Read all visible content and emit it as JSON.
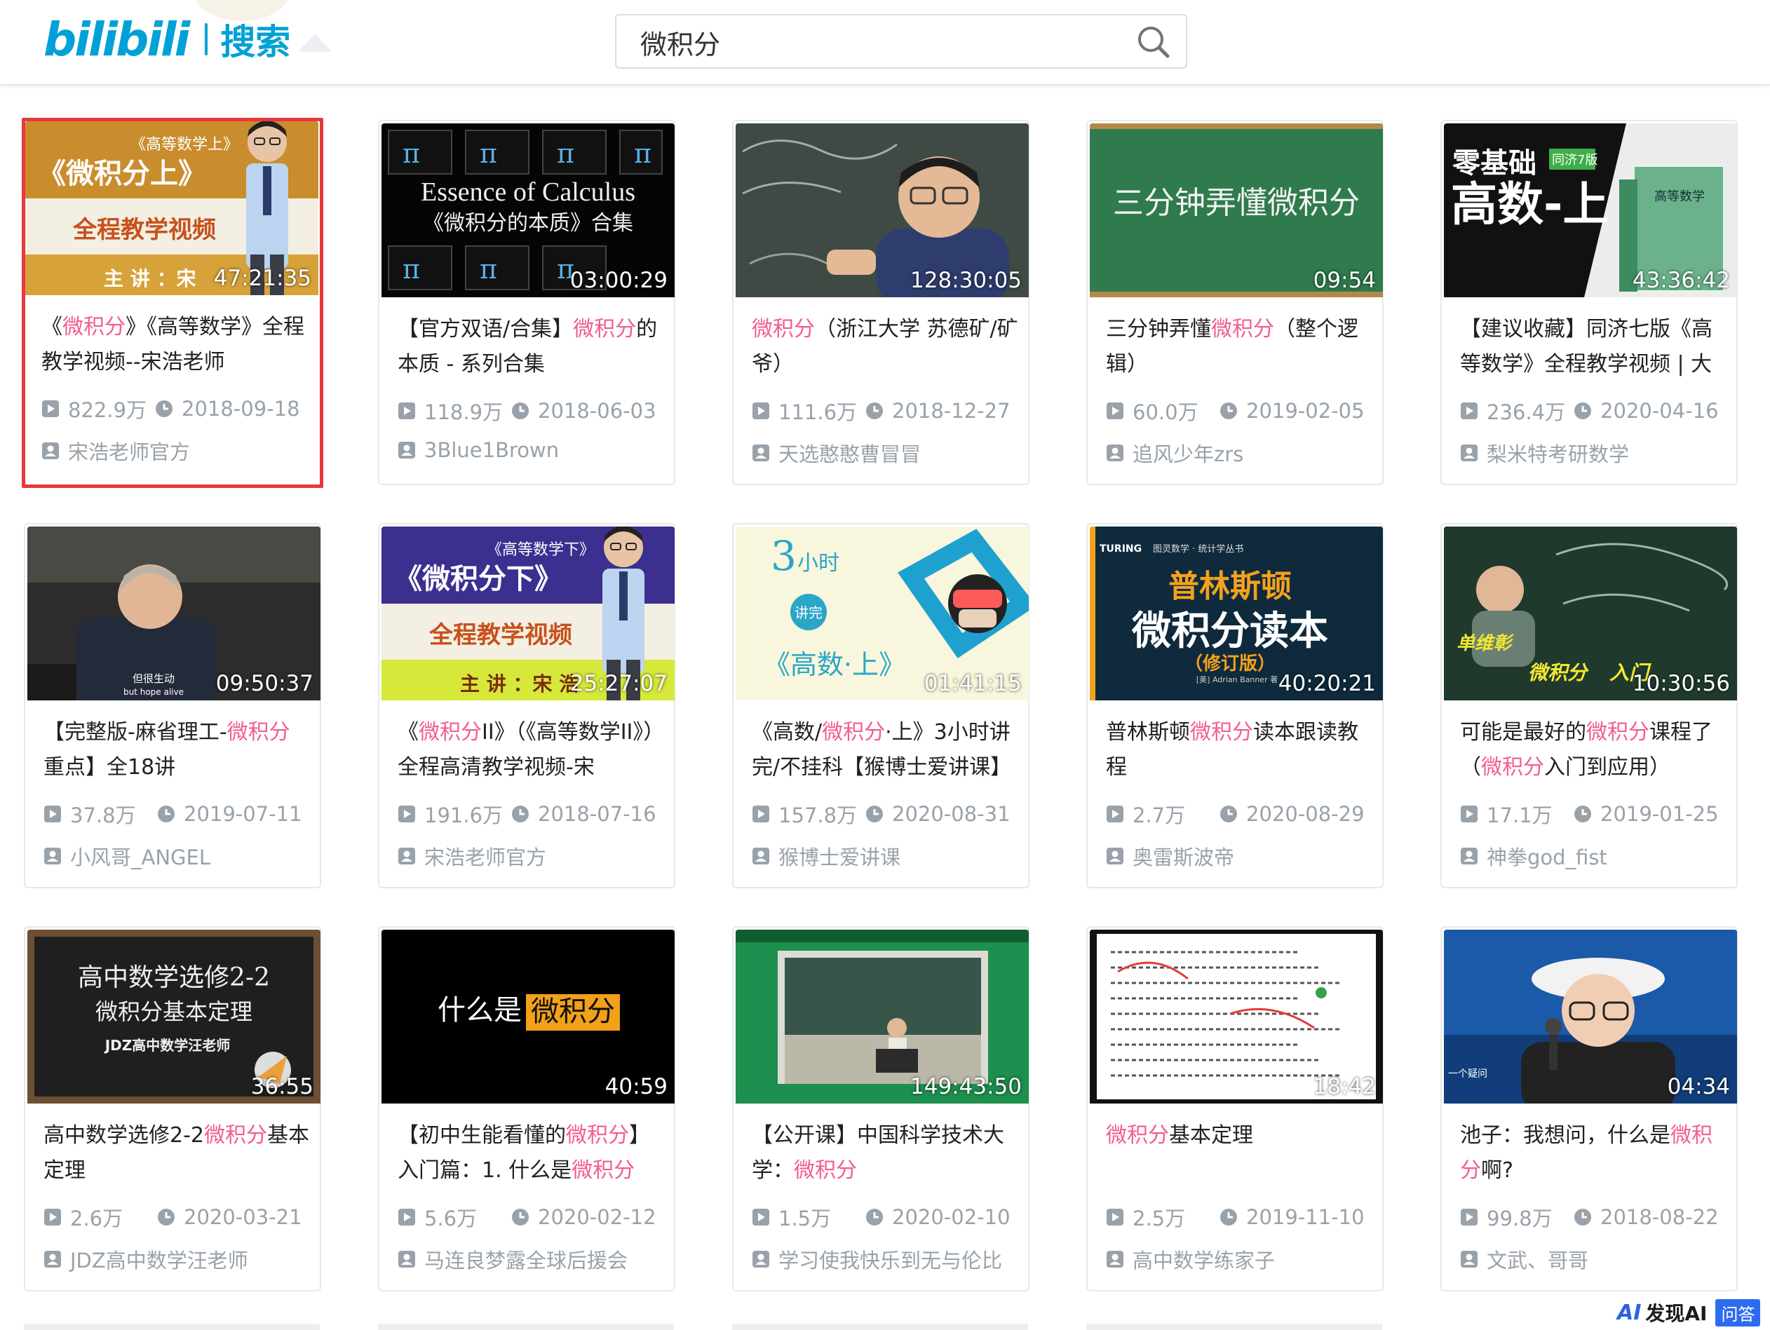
{
  "header": {
    "logo_text": "bilibili",
    "logo_subtitle": "搜索",
    "search_value": "微积分"
  },
  "cards": [
    {
      "title_parts": [
        [
          "《",
          0
        ],
        [
          "微积分",
          1
        ],
        [
          "》《高等数学》全程教学视频--宋浩老师",
          0
        ]
      ],
      "duration": "47:21:35",
      "views": "822.9万",
      "date": "2018-09-18",
      "author": "宋浩老师官方",
      "selected": true
    },
    {
      "title_parts": [
        [
          "【官方双语/合集】",
          0
        ],
        [
          "微积分",
          1
        ],
        [
          "的本质 - 系列合集",
          0
        ]
      ],
      "duration": "03:00:29",
      "views": "118.9万",
      "date": "2018-06-03",
      "author": "3Blue1Brown"
    },
    {
      "title_parts": [
        [
          "微积分",
          1
        ],
        [
          "（浙江大学 苏德矿/矿爷）",
          0
        ]
      ],
      "duration": "128:30:05",
      "views": "111.6万",
      "date": "2018-12-27",
      "author": "天选憨憨曹冒冒"
    },
    {
      "title_parts": [
        [
          "三分钟弄懂",
          0
        ],
        [
          "微积分",
          1
        ],
        [
          "（整个逻辑）",
          0
        ]
      ],
      "duration": "09:54",
      "views": "60.0万",
      "date": "2019-02-05",
      "author": "追风少年zrs"
    },
    {
      "title_parts": [
        [
          "【建议收藏】同济七版《高等数学》全程教学视频 | 大",
          0
        ]
      ],
      "duration": "43:36:42",
      "views": "236.4万",
      "date": "2020-04-16",
      "author": "梨米特考研数学"
    },
    {
      "title_parts": [
        [
          "【完整版-麻省理工-",
          0
        ],
        [
          "微积分",
          1
        ],
        [
          "重点】全18讲",
          0
        ]
      ],
      "duration": "09:50:37",
      "views": "37.8万",
      "date": "2019-07-11",
      "author": "小风哥_ANGEL"
    },
    {
      "title_parts": [
        [
          "《",
          0
        ],
        [
          "微积分",
          1
        ],
        [
          "II》（《高等数学II》）全程高清教学视频-宋",
          0
        ]
      ],
      "duration": "25:27:07",
      "views": "191.6万",
      "date": "2018-07-16",
      "author": "宋浩老师官方"
    },
    {
      "title_parts": [
        [
          "《高数/",
          0
        ],
        [
          "微积分",
          1
        ],
        [
          "·上》3小时讲完/不挂科【猴博士爱讲课】",
          0
        ]
      ],
      "duration": "01:41:15",
      "views": "157.8万",
      "date": "2020-08-31",
      "author": "猴博士爱讲课"
    },
    {
      "title_parts": [
        [
          "普林斯顿",
          0
        ],
        [
          "微积分",
          1
        ],
        [
          "读本跟读教程",
          0
        ]
      ],
      "duration": "40:20:21",
      "views": "2.7万",
      "date": "2020-08-29",
      "author": "奥雷斯波帝"
    },
    {
      "title_parts": [
        [
          "可能是最好的",
          0
        ],
        [
          "微积分",
          1
        ],
        [
          "课程了（",
          0
        ],
        [
          "微积分",
          1
        ],
        [
          "入门到应用）",
          0
        ]
      ],
      "duration": "10:30:56",
      "views": "17.1万",
      "date": "2019-01-25",
      "author": "神拳god_fist"
    },
    {
      "title_parts": [
        [
          "高中数学选修2-2",
          0
        ],
        [
          "微积分",
          1
        ],
        [
          "基本定理",
          0
        ]
      ],
      "duration": "36:55",
      "views": "2.6万",
      "date": "2020-03-21",
      "author": "JDZ高中数学汪老师"
    },
    {
      "title_parts": [
        [
          "【初中生能看懂的",
          0
        ],
        [
          "微积分",
          1
        ],
        [
          "】入门篇：1. 什么是",
          0
        ],
        [
          "微积分",
          1
        ]
      ],
      "duration": "40:59",
      "views": "5.6万",
      "date": "2020-02-12",
      "author": "马连良梦露全球后援会"
    },
    {
      "title_parts": [
        [
          "【公开课】中国科学技术大学：",
          0
        ],
        [
          "微积分",
          1
        ]
      ],
      "duration": "149:43:50",
      "views": "1.5万",
      "date": "2020-02-10",
      "author": "学习使我快乐到无与伦比"
    },
    {
      "title_parts": [
        [
          "微积分",
          1
        ],
        [
          "基本定理",
          0
        ]
      ],
      "duration": "18:42",
      "views": "2.5万",
      "date": "2019-11-10",
      "author": "高中数学练家子"
    },
    {
      "title_parts": [
        [
          "池子：我想问，什么是",
          0
        ],
        [
          "微积分",
          1
        ],
        [
          "啊?",
          0
        ]
      ],
      "duration": "04:34",
      "views": "99.8万",
      "date": "2018-08-22",
      "author": "文武、哥哥"
    }
  ],
  "thumb_text": {
    "t1": {
      "top": "《高等数学上》",
      "main": "《微积分上》",
      "band": "全程教学视频",
      "lect": "主 讲 ：宋"
    },
    "t2": {
      "l1": "Essence of Calculus",
      "l2": "《微积分的本质》合集"
    },
    "t4": {
      "main": "三分钟弄懂微积分"
    },
    "t5": {
      "a": "零基础",
      "b": "高数-上",
      "badge": "同济7版",
      "book": "高等数学"
    },
    "t6": {
      "sub": "但很生动",
      "sub2": "but hope alive"
    },
    "t7": {
      "top": "《高等数学下》",
      "main": "《微积分下》",
      "band": "全程教学视频",
      "lect": "主 讲 ：宋 浩"
    },
    "t8": {
      "num": "3",
      "unit": "小时",
      "badge": "讲完",
      "main": "《高数·上》"
    },
    "t9": {
      "brand": "TURING",
      "series": "图灵数学 · 统计学丛书",
      "l1": "普林斯顿",
      "l2": "微积分读本",
      "l3": "（修订版）",
      "author": "[美] Adrian Banner 著"
    },
    "t10": {
      "a": "单维彰",
      "b": "微积分",
      "c": "入门"
    },
    "t11": {
      "l1": "高中数学选修2-2",
      "l2": "微积分基本定理",
      "l3": "JDZ高中数学汪老师"
    },
    "t12": {
      "a": "什么是",
      "b": "微积分"
    },
    "t15": {
      "cap": "一个疑问"
    }
  },
  "watermark": {
    "brand": "AI",
    "text": "发现AI",
    "button": "问答"
  },
  "colors": {
    "accent": "#00a1d6",
    "highlight": "#f25d8e",
    "selected_border": "#e8383e",
    "meta": "#99a2aa"
  }
}
